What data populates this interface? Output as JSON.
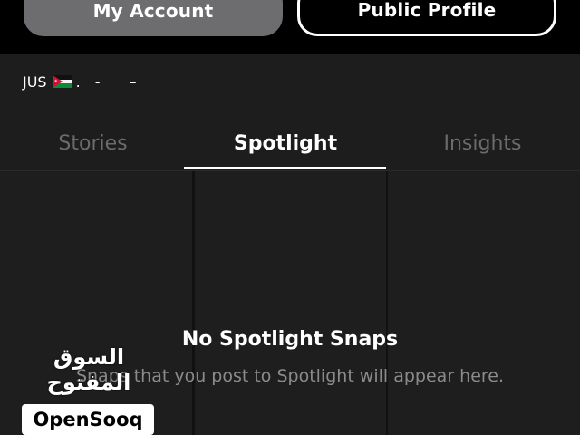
{
  "header": {
    "my_account_label": "My Account",
    "public_profile_label": "Public Profile"
  },
  "profile_meta": {
    "prefix": "JUS",
    "flag_icon": "jordan-flag-icon",
    "after_flag": ".",
    "sep1": "-",
    "sep2": "–"
  },
  "tabs": [
    {
      "label": "Stories",
      "active": false
    },
    {
      "label": "Spotlight",
      "active": true
    },
    {
      "label": "Insights",
      "active": false
    }
  ],
  "empty_state": {
    "title": "No Spotlight Snaps",
    "subtitle": "Snaps that you post to Spotlight will appear here."
  },
  "watermark": {
    "arabic": "السوق المفتوح",
    "logo": "OpenSooq"
  },
  "colors": {
    "background": "#000000",
    "panel": "#1d1d1d",
    "active_tab": "#ffffff",
    "inactive_tab": "#6b6b6b",
    "my_account_button": "#6d6d70"
  }
}
